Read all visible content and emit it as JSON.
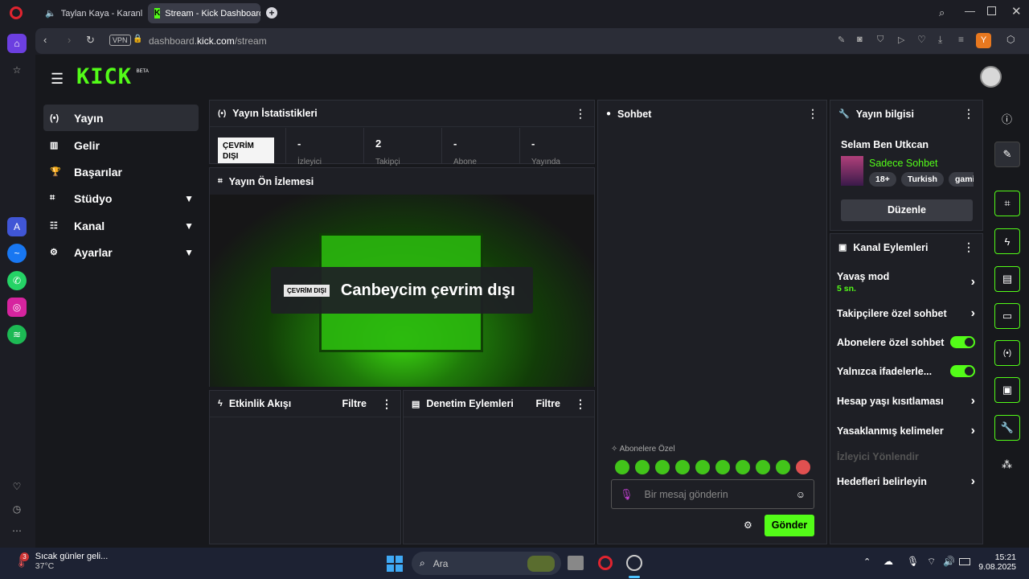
{
  "browser": {
    "tabs": [
      {
        "label": "Taylan Kaya - Karanlık"
      },
      {
        "label": "Stream - Kick Dashboard"
      }
    ],
    "url_prefix": "dashboard.",
    "url_domain": "kick.com",
    "url_path": "/stream",
    "vpn": "VPN",
    "profile": "Y"
  },
  "kick": {
    "logo": "KICK",
    "beta": "BETA"
  },
  "nav": [
    {
      "label": "Yayın",
      "icon": "(•)"
    },
    {
      "label": "Gelir",
      "icon": "▥"
    },
    {
      "label": "Başarılar",
      "icon": "🏆"
    },
    {
      "label": "Stüdyo",
      "icon": "⌗"
    },
    {
      "label": "Kanal",
      "icon": "☷"
    },
    {
      "label": "Ayarlar",
      "icon": "⚙"
    }
  ],
  "stats": {
    "title": "Yayın İstatistikleri",
    "status": "ÇEVRİM DIŞI",
    "items": [
      {
        "value": "-",
        "label": "İzleyici"
      },
      {
        "value": "2",
        "label": "Takipçi"
      },
      {
        "value": "-",
        "label": "Abone"
      },
      {
        "value": "-",
        "label": "Yayında"
      }
    ]
  },
  "preview": {
    "title": "Yayın Ön İzlemesi",
    "badge": "ÇEVRİM DIŞI",
    "text": "Canbeycim çevrim dışı"
  },
  "activity": {
    "title": "Etkinlik Akışı",
    "filter": "Filtre"
  },
  "moderation": {
    "title": "Denetim Eylemleri",
    "filter": "Filtre"
  },
  "chat": {
    "title": "Sohbet",
    "subs_label": "Abonelere Özel",
    "placeholder": "Bir mesaj gönderin",
    "send": "Gönder"
  },
  "info": {
    "title": "Yayın bilgisi",
    "stream_title": "Selam Ben Utkcan",
    "category": "Sadece Sohbet",
    "tags": [
      "18+",
      "Turkish",
      "gamin"
    ],
    "edit": "Düzenle"
  },
  "actions": {
    "title": "Kanal Eylemleri",
    "slow_mode": "Yavaş mod",
    "slow_value": "5 sn.",
    "followers_only": "Takipçilere özel sohbet",
    "subs_only": "Abonelere özel sohbet",
    "emotes_only": "Yalnızca ifadelerle...",
    "account_age": "Hesap yaşı kısıtlaması",
    "banned_words": "Yasaklanmış kelimeler",
    "redirect": "İzleyici Yönlendir",
    "goals": "Hedefleri belirleyin"
  },
  "taskbar": {
    "weather_title": "Sıcak günler geli...",
    "weather_temp": "37°C",
    "weather_badge": "3",
    "search": "Ara",
    "time": "15:21",
    "date": "9.08.2025"
  },
  "colors": {
    "accent": "#53fc18",
    "panel": "#1e1f25",
    "page": "#17181c"
  }
}
